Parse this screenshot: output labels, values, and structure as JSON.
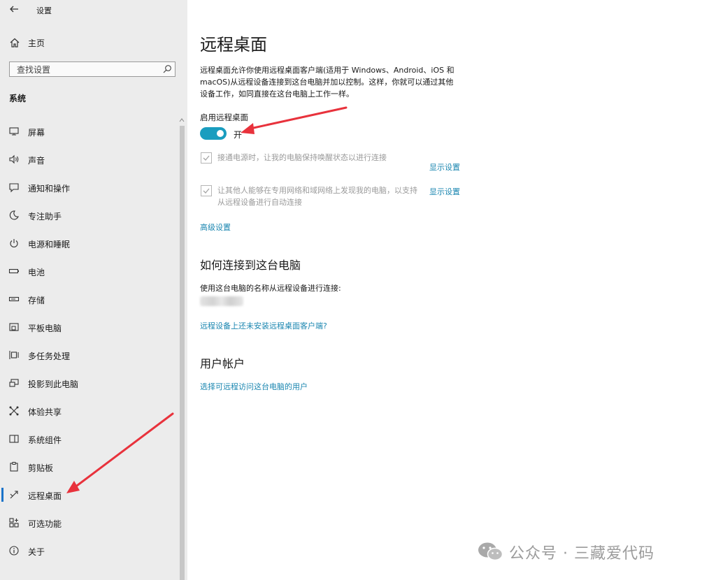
{
  "window": {
    "title": "设置"
  },
  "sidebar": {
    "home_label": "主页",
    "search_placeholder": "查找设置",
    "section_title": "系统",
    "items": [
      {
        "label": "屏幕",
        "icon": "monitor-icon"
      },
      {
        "label": "声音",
        "icon": "speaker-icon"
      },
      {
        "label": "通知和操作",
        "icon": "notification-icon"
      },
      {
        "label": "专注助手",
        "icon": "moon-icon"
      },
      {
        "label": "电源和睡眠",
        "icon": "power-icon"
      },
      {
        "label": "电池",
        "icon": "battery-icon"
      },
      {
        "label": "存储",
        "icon": "storage-icon"
      },
      {
        "label": "平板电脑",
        "icon": "tablet-icon"
      },
      {
        "label": "多任务处理",
        "icon": "multitask-icon"
      },
      {
        "label": "投影到此电脑",
        "icon": "project-icon"
      },
      {
        "label": "体验共享",
        "icon": "share-icon"
      },
      {
        "label": "系统组件",
        "icon": "components-icon"
      },
      {
        "label": "剪贴板",
        "icon": "clipboard-icon"
      },
      {
        "label": "远程桌面",
        "icon": "remote-desktop-icon",
        "active": true
      },
      {
        "label": "可选功能",
        "icon": "optional-features-icon"
      },
      {
        "label": "关于",
        "icon": "info-icon"
      }
    ]
  },
  "main": {
    "title": "远程桌面",
    "description": "远程桌面允许你使用远程桌面客户端(适用于 Windows、Android、iOS 和 macOS)从远程设备连接到这台电脑并加以控制。这样，你就可以通过其他设备工作，如同直接在这台电脑上工作一样。",
    "toggle_label": "启用远程桌面",
    "toggle_state": "开",
    "checkbox1_text": "接通电源时，让我的电脑保持唤醒状态以进行连接",
    "checkbox1_link": "显示设置",
    "checkbox2_text": "让其他人能够在专用网络和域网络上发现我的电脑，以支持从远程设备进行自动连接",
    "checkbox2_link": "显示设置",
    "advanced_link": "高级设置",
    "connect_heading": "如何连接到这台电脑",
    "connect_text": "使用这台电脑的名称从远程设备进行连接:",
    "client_link": "远程设备上还未安装远程桌面客户端?",
    "accounts_heading": "用户帐户",
    "accounts_link": "选择可远程访问这台电脑的用户"
  },
  "watermark": {
    "text": "公众号 · 三藏爱代码"
  },
  "colors": {
    "accent": "#1a9dbf",
    "link": "#1a86b0",
    "annotation": "#e8323c",
    "sidebar_bg": "#ececec"
  }
}
